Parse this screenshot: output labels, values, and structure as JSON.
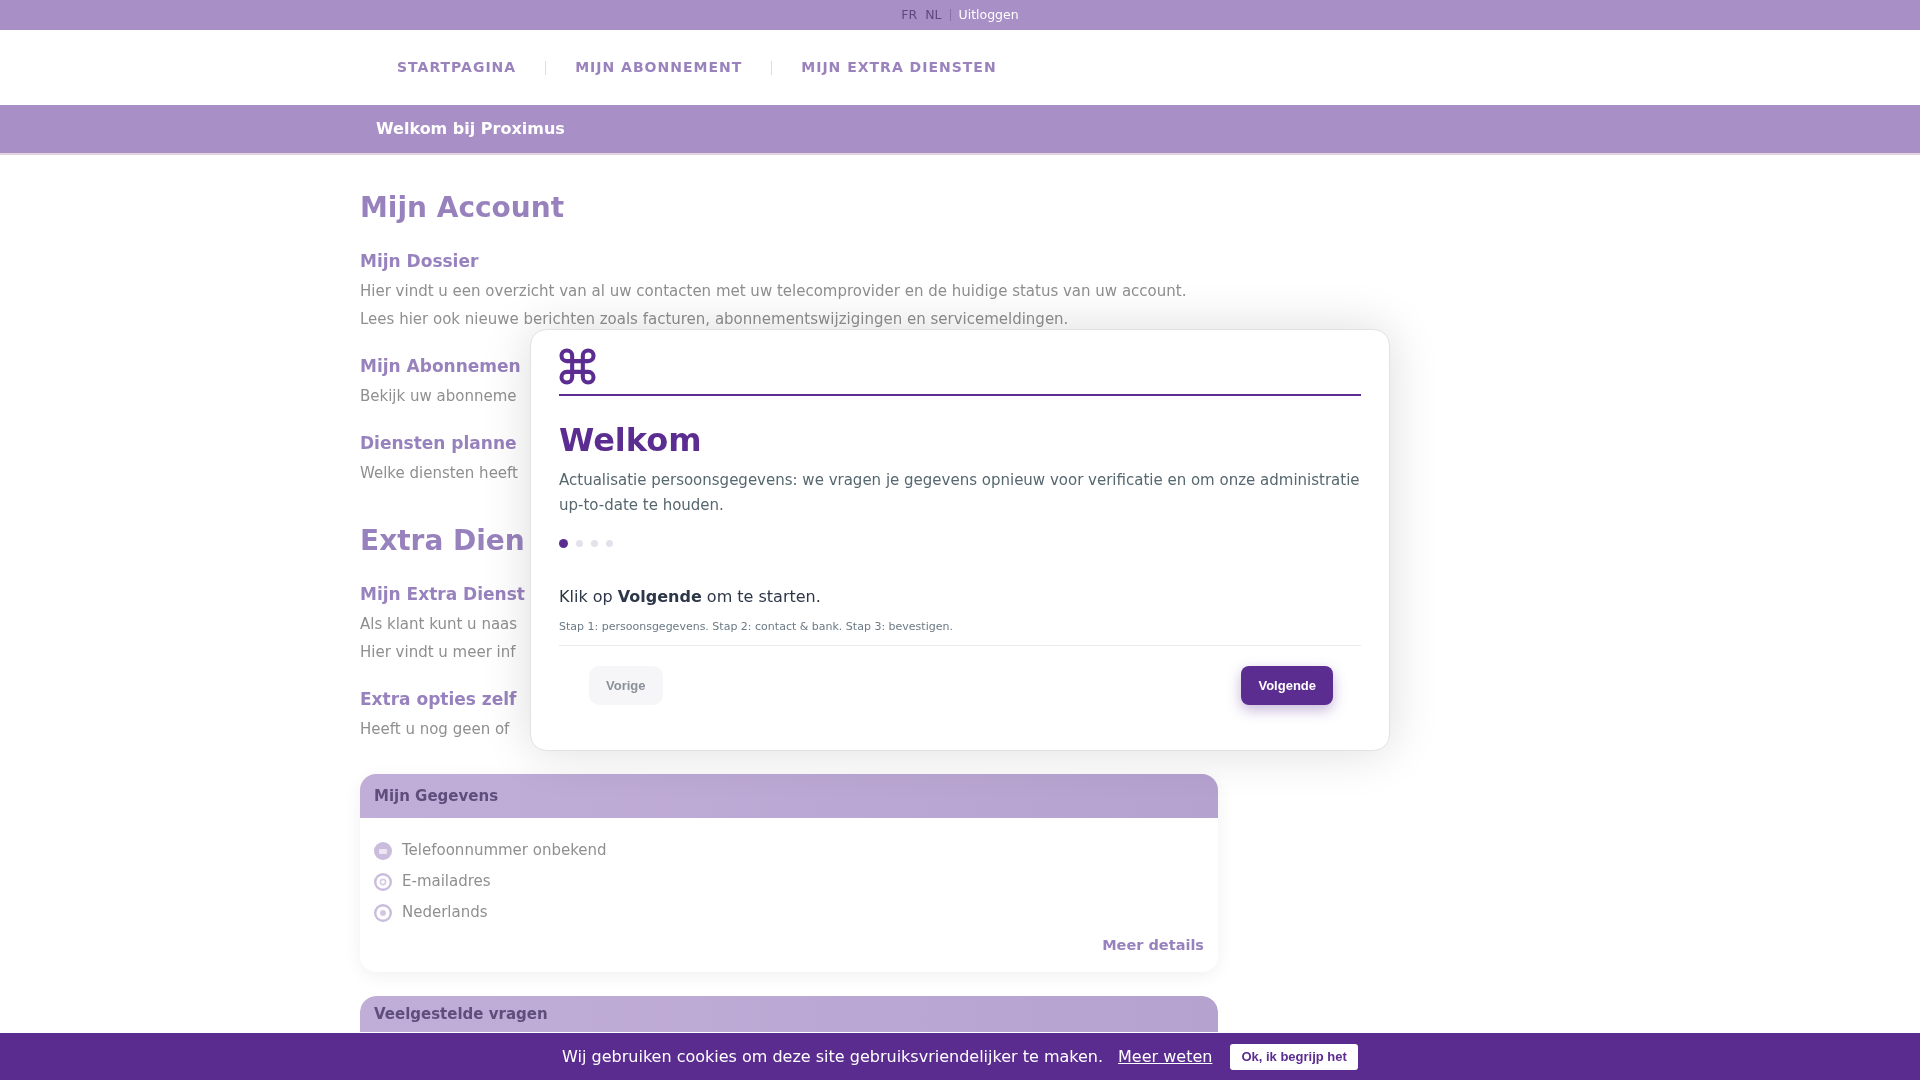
{
  "top_bar": {
    "languages": [
      {
        "label": "FR"
      },
      {
        "label": "NL"
      }
    ],
    "logout": "Uitloggen"
  },
  "nav": {
    "items": [
      {
        "label": "STARTPAGINA"
      },
      {
        "label": "MIJN ABONNEMENT"
      },
      {
        "label": "MIJN EXTRA DIENSTEN"
      }
    ]
  },
  "welcome_bar": {
    "text": "Welkom bij Proximus"
  },
  "sections": [
    {
      "title": "Mijn Account",
      "blocks": [
        {
          "heading": "Mijn Dossier",
          "paragraphs": [
            "Hier vindt u een overzicht van al uw contacten met uw telecomprovider en de huidige status van uw account.",
            "Lees hier ook nieuwe berichten zoals facturen, abonnementswijzigingen en servicemeldingen."
          ]
        },
        {
          "heading": "Mijn Abonnemen",
          "paragraphs": [
            "Bekijk uw abonneme"
          ]
        },
        {
          "heading": "Diensten planne",
          "paragraphs": [
            "Welke diensten heeft"
          ]
        }
      ]
    },
    {
      "title": "Extra Dien",
      "blocks": [
        {
          "heading": "Mijn Extra Dienst",
          "paragraphs": [
            "Als klant kunt u naas",
            "Hier vindt u meer inf"
          ]
        },
        {
          "heading": "Extra opties zelf",
          "paragraphs": [
            "Heeft u nog geen of"
          ]
        }
      ]
    }
  ],
  "cards": [
    {
      "title": "Mijn Gegevens",
      "items": [
        {
          "text": "Telefoonnummer onbekend"
        },
        {
          "text": "E-mailadres"
        },
        {
          "text": "Nederlands"
        }
      ],
      "link": "Meer details"
    },
    {
      "title": "Veelgestelde vragen"
    }
  ],
  "modal": {
    "title": "Welkom",
    "text": "Actualisatie persoonsgegevens: we vragen je gegevens opnieuw voor verificatie en om onze administratie up-to-date te houden.",
    "step_dots": [
      {
        "selected": true
      },
      {
        "selected": false
      },
      {
        "selected": false
      },
      {
        "selected": false
      }
    ],
    "instruction": "Klik op **Volgende** om te starten.",
    "note": "Stap 1: persoonsgegevens. Stap 2: contact & bank. Stap 3: bevestigen.",
    "buttons": [
      {
        "label": "Vorige",
        "kind": "secondary",
        "disabled": true
      },
      {
        "label": "Volgende",
        "kind": "primary",
        "disabled": false
      }
    ]
  },
  "cookie_bar": {
    "text": "Wij gebruiken cookies om deze site gebruiksvriendelijker te maken.",
    "link": "Meer weten",
    "button": "Ok, ik begrijp het"
  }
}
